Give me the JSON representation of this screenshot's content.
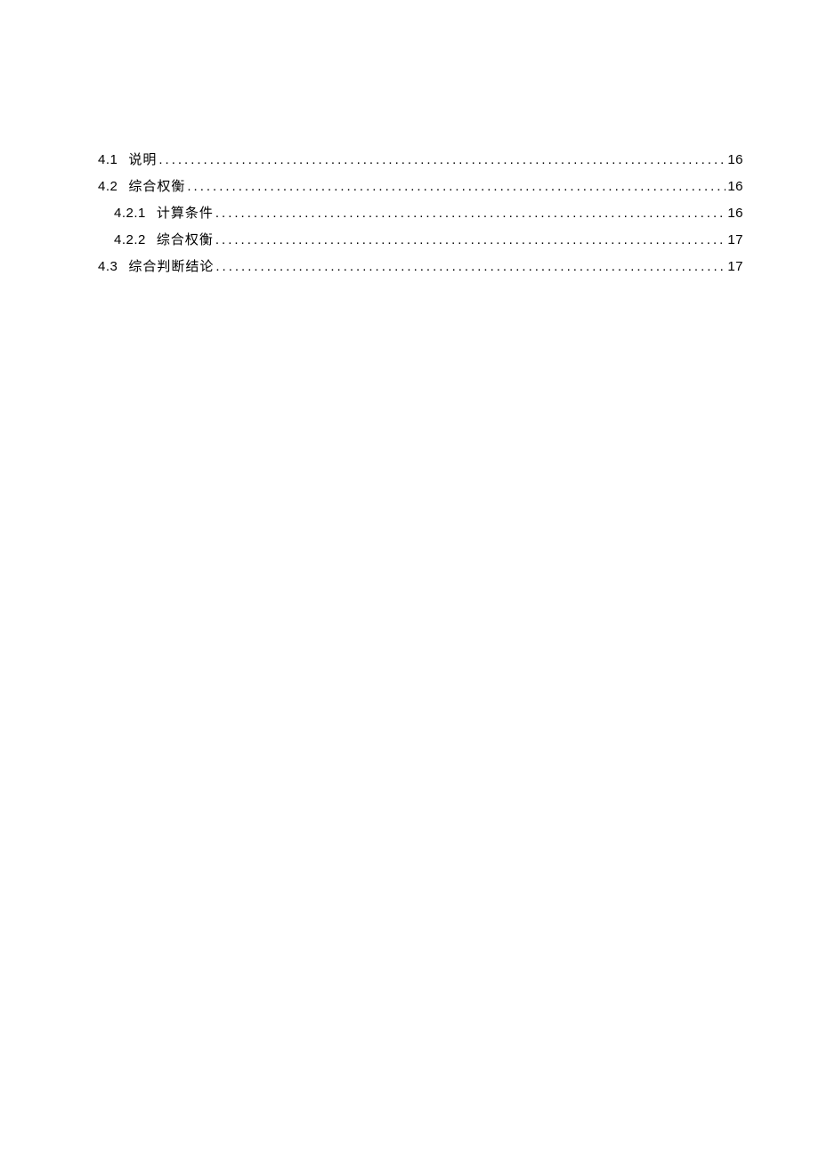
{
  "toc": [
    {
      "level": 1,
      "number": "4.1",
      "title": "说明",
      "page": "16"
    },
    {
      "level": 1,
      "number": "4.2",
      "title": "综合权衡",
      "page": "16"
    },
    {
      "level": 2,
      "number": "4.2.1",
      "title": "计算条件",
      "page": "16"
    },
    {
      "level": 2,
      "number": "4.2.2",
      "title": "综合权衡",
      "page": "17"
    },
    {
      "level": 1,
      "number": "4.3",
      "title": "综合判断结论",
      "page": "17"
    }
  ]
}
